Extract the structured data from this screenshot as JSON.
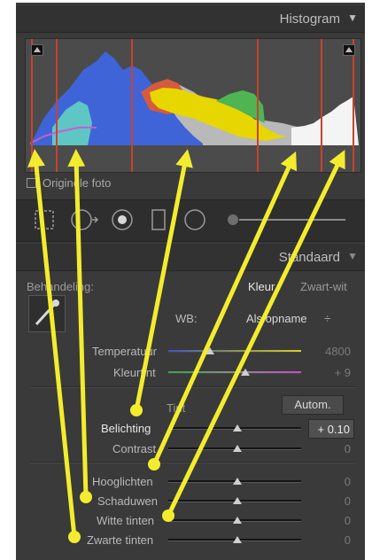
{
  "histogram_panel": {
    "title": "Histogram",
    "original_photo_label": "Originele foto"
  },
  "basic_panel": {
    "title": "Standaard",
    "treatment_label": "Behandeling:",
    "color_option": "Kleur",
    "bw_option": "Zwart-wit",
    "wb_label": "WB:",
    "wb_value": "Als opname",
    "temp_label": "Temperatuur",
    "temp_value": "4800",
    "tint_label": "Kleurtint",
    "tint_value": "+ 9",
    "tone_label": "Tint",
    "auto_button": "Autom.",
    "exposure_label": "Belichting",
    "exposure_value": "+ 0.10",
    "contrast_label": "Contrast",
    "contrast_value": "0",
    "highlights_label": "Hooglichten",
    "highlights_value": "0",
    "shadows_label": "Schaduwen",
    "shadows_value": "0",
    "whites_label": "Witte tinten",
    "whites_value": "0",
    "blacks_label": "Zwarte tinten",
    "blacks_value": "0"
  },
  "colors": {
    "annotation": "#f3ec2e",
    "marker_lines": "#c8432d",
    "panel_bg": "#3a3a3a"
  }
}
